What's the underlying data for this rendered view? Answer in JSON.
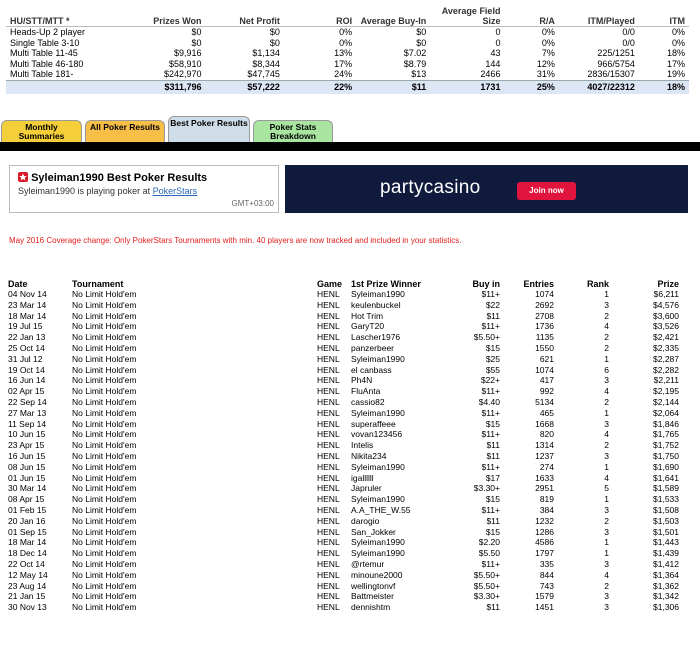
{
  "summary": {
    "headers": [
      "HU/STT/MTT *",
      "Prizes Won",
      "Net Profit",
      "ROI",
      "Average Buy-In",
      "Average Field Size",
      "R/A",
      "ITM/Played",
      "ITM"
    ],
    "rows": [
      [
        "Heads-Up 2 player",
        "$0",
        "$0",
        "0%",
        "$0",
        "0",
        "0%",
        "0/0",
        "0%"
      ],
      [
        "Single Table 3-10",
        "$0",
        "$0",
        "0%",
        "$0",
        "0",
        "0%",
        "0/0",
        "0%"
      ],
      [
        "Multi Table 11-45",
        "$9,916",
        "$1,134",
        "13%",
        "$7.02",
        "43",
        "7%",
        "225/1251",
        "18%"
      ],
      [
        "Multi Table 46-180",
        "$58,910",
        "$8,344",
        "17%",
        "$8.79",
        "144",
        "12%",
        "966/5754",
        "17%"
      ],
      [
        "Multi Table 181-",
        "$242,970",
        "$47,745",
        "24%",
        "$13",
        "2466",
        "31%",
        "2836/15307",
        "19%"
      ]
    ],
    "total": [
      "",
      "$311,796",
      "$57,222",
      "22%",
      "$11",
      "1731",
      "25%",
      "4027/22312",
      "18%"
    ]
  },
  "tabs": [
    {
      "label": "Monthly Summaries",
      "color": "#f5cf3a"
    },
    {
      "label": "All Poker Results",
      "color": "#f7bf47"
    },
    {
      "label": "Best Poker Results",
      "color": "#cfdde8"
    },
    {
      "label": "Poker Stats Breakdown",
      "color": "#a9e4a1"
    }
  ],
  "best_box": {
    "title": "Syleiman1990 Best Poker Results",
    "sub_prefix": "Syleiman1990 is playing poker at ",
    "sub_link": "PokerStars",
    "gmt": "GMT+03:00"
  },
  "ad": {
    "logo": "partycasino",
    "button": "Join now"
  },
  "notice": "May 2016 Coverage change: Only PokerStars Tournaments with min. 40 players are now tracked and included in your statistics.",
  "results": {
    "headers": [
      "Date",
      "Tournament",
      "Game",
      "1st Prize Winner",
      "Buy in",
      "Entries",
      "Rank",
      "Prize"
    ],
    "rows": [
      [
        "04 Nov 14",
        "No Limit Hold'em",
        "HENL",
        "Syleiman1990",
        "$11+",
        "1074",
        "1",
        "$6,211"
      ],
      [
        "23 Mar 14",
        "No Limit Hold'em",
        "HENL",
        "keulenbuckel",
        "$22",
        "2692",
        "3",
        "$4,576"
      ],
      [
        "18 Mar 14",
        "No Limit Hold'em",
        "HENL",
        "Hot Trim",
        "$11",
        "2708",
        "2",
        "$3,600"
      ],
      [
        "19 Jul 15",
        "No Limit Hold'em",
        "HENL",
        "GaryT20",
        "$11+",
        "1736",
        "4",
        "$3,526"
      ],
      [
        "22 Jan 13",
        "No Limit Hold'em",
        "HENL",
        "Lascher1976",
        "$5.50+",
        "1135",
        "2",
        "$2,421"
      ],
      [
        "25 Oct 14",
        "No Limit Hold'em",
        "HENL",
        "panzerbeer",
        "$15",
        "1550",
        "2",
        "$2,335"
      ],
      [
        "31 Jul 12",
        "No Limit Hold'em",
        "HENL",
        "Syleiman1990",
        "$25",
        "621",
        "1",
        "$2,287"
      ],
      [
        "19 Oct 14",
        "No Limit Hold'em",
        "HENL",
        "el canbass",
        "$55",
        "1074",
        "6",
        "$2,282"
      ],
      [
        "16 Jun 14",
        "No Limit Hold'em",
        "HENL",
        "Ph4N",
        "$22+",
        "417",
        "3",
        "$2,211"
      ],
      [
        "02 Apr 15",
        "No Limit Hold'em",
        "HENL",
        "FluAnta",
        "$11+",
        "992",
        "4",
        "$2,195"
      ],
      [
        "22 Sep 14",
        "No Limit Hold'em",
        "HENL",
        "cassio82",
        "$4.40",
        "5134",
        "2",
        "$2,144"
      ],
      [
        "27 Mar 13",
        "No Limit Hold'em",
        "HENL",
        "Syleiman1990",
        "$11+",
        "465",
        "1",
        "$2,064"
      ],
      [
        "11 Sep 14",
        "No Limit Hold'em",
        "HENL",
        "superaffeee",
        "$15",
        "1668",
        "3",
        "$1,846"
      ],
      [
        "10 Jun 15",
        "No Limit Hold'em",
        "HENL",
        "vovan123456",
        "$11+",
        "820",
        "4",
        "$1,765"
      ],
      [
        "23 Apr 15",
        "No Limit Hold'em",
        "HENL",
        "Intelis",
        "$11",
        "1314",
        "2",
        "$1,752"
      ],
      [
        "16 Jun 15",
        "No Limit Hold'em",
        "HENL",
        "Nikita234",
        "$11",
        "1237",
        "3",
        "$1,750"
      ],
      [
        "08 Jun 15",
        "No Limit Hold'em",
        "HENL",
        "Syleiman1990",
        "$11+",
        "274",
        "1",
        "$1,690"
      ],
      [
        "01 Jun 15",
        "No Limit Hold'em",
        "HENL",
        "igallllll",
        "$17",
        "1633",
        "4",
        "$1,641"
      ],
      [
        "30 Mar 14",
        "No Limit Hold'em",
        "HENL",
        "Japruler",
        "$3.30+",
        "2951",
        "5",
        "$1,589"
      ],
      [
        "08 Apr 15",
        "No Limit Hold'em",
        "HENL",
        "Syleiman1990",
        "$15",
        "819",
        "1",
        "$1,533"
      ],
      [
        "01 Feb 15",
        "No Limit Hold'em",
        "HENL",
        "A.A_THE_W.55",
        "$11+",
        "384",
        "3",
        "$1,508"
      ],
      [
        "20 Jan 16",
        "No Limit Hold'em",
        "HENL",
        "darogio",
        "$11",
        "1232",
        "2",
        "$1,503"
      ],
      [
        "01 Sep 15",
        "No Limit Hold'em",
        "HENL",
        "San_Jokker",
        "$15",
        "1286",
        "3",
        "$1,501"
      ],
      [
        "18 Mar 14",
        "No Limit Hold'em",
        "HENL",
        "Syleiman1990",
        "$2.20",
        "4586",
        "1",
        "$1,443"
      ],
      [
        "18 Dec 14",
        "No Limit Hold'em",
        "HENL",
        "Syleiman1990",
        "$5.50",
        "1797",
        "1",
        "$1,439"
      ],
      [
        "22 Oct 14",
        "No Limit Hold'em",
        "HENL",
        "@rtemur",
        "$11+",
        "335",
        "3",
        "$1,412"
      ],
      [
        "12 May 14",
        "No Limit Hold'em",
        "HENL",
        "minoune2000",
        "$5.50+",
        "844",
        "4",
        "$1,364"
      ],
      [
        "23 Aug 14",
        "No Limit Hold'em",
        "HENL",
        "wellingtonvf",
        "$5.50+",
        "743",
        "2",
        "$1,362"
      ],
      [
        "21 Jan 15",
        "No Limit Hold'em",
        "HENL",
        "Battmeister",
        "$3.30+",
        "1579",
        "3",
        "$1,342"
      ],
      [
        "30 Nov 13",
        "No Limit Hold'em",
        "HENL",
        "dennishtm",
        "$11",
        "1451",
        "3",
        "$1,306"
      ]
    ]
  }
}
